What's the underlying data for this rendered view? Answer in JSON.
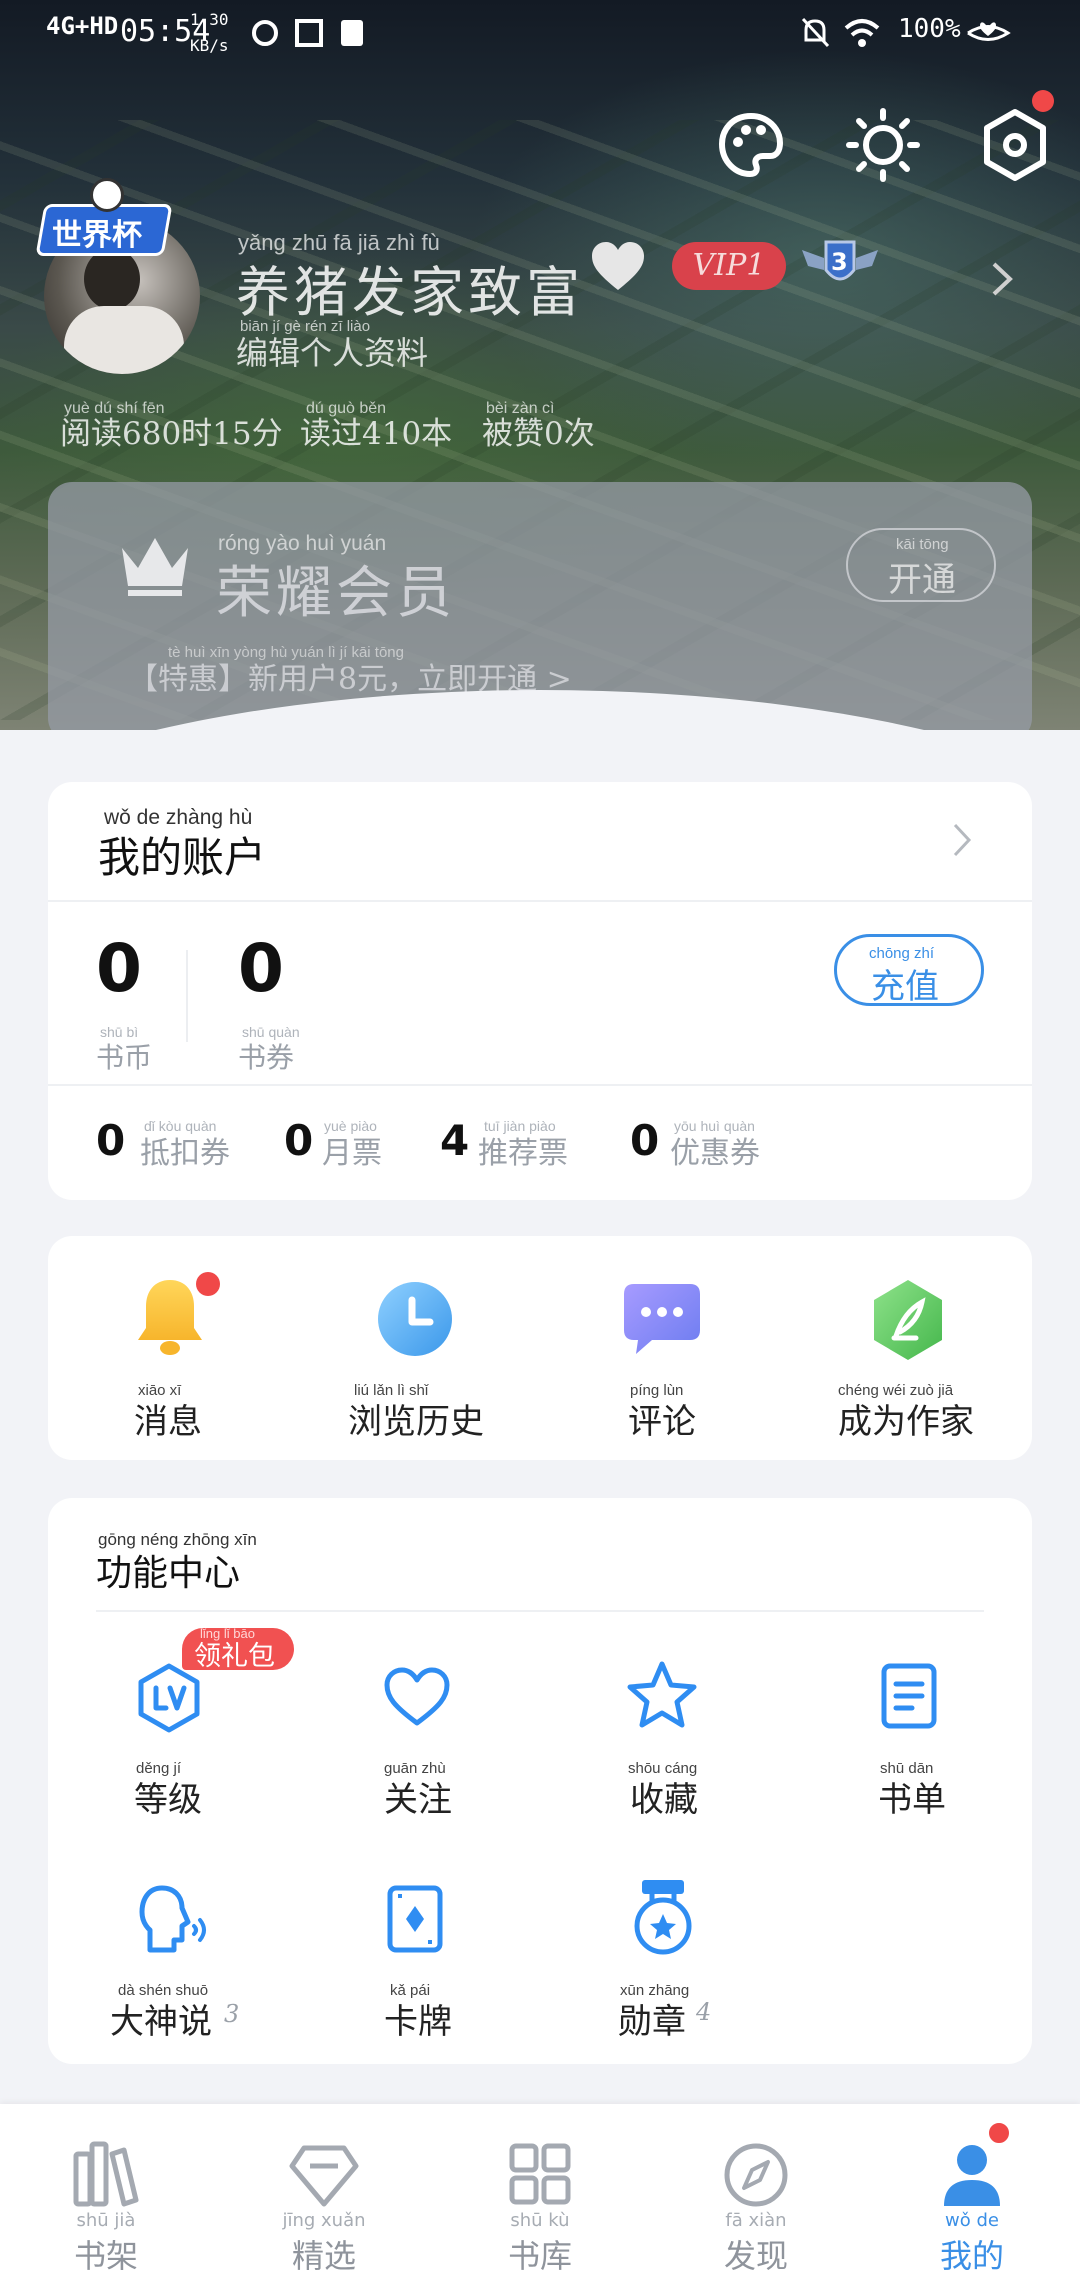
{
  "status": {
    "network": "4G+HD",
    "time": "05:54",
    "speed": "1.30",
    "speed_unit": "KB/s",
    "battery": "100%"
  },
  "profile": {
    "name": "养猪发家致富",
    "name_pinyin": "yǎng zhū fā jiā zhì fù",
    "vip": "VIP1",
    "badge_level": "3",
    "edit": "编辑个人资料",
    "edit_pinyin": "biān jí gè rén zī liào",
    "stats": [
      {
        "text": "阅读680时15分",
        "pinyin": "yuè dú shí fēn"
      },
      {
        "text": "读过410本",
        "pinyin": "dú guò běn"
      },
      {
        "text": "被赞0次",
        "pinyin": "bèi zàn cì"
      }
    ],
    "avatar_badge": "世界杯"
  },
  "vip_card": {
    "title": "荣耀会员",
    "title_pinyin": "róng yào huì yuán",
    "open": "开通",
    "open_pinyin": "kāi tōng",
    "promo": "【特惠】新用户8元，立即开通 >",
    "promo_pinyin": "tè huì xīn yòng hù yuán lì jí kāi tōng"
  },
  "account": {
    "title": "我的账户",
    "title_pinyin": "wǒ de zhàng hù",
    "coins": {
      "value": "0",
      "label": "书币",
      "pinyin": "shū bì"
    },
    "coupons": {
      "value": "0",
      "label": "书券",
      "pinyin": "shū quàn"
    },
    "recharge": "充值",
    "recharge_pinyin": "chōng zhí",
    "items": [
      {
        "value": "0",
        "label": "抵扣券",
        "pinyin": "dǐ kòu quàn"
      },
      {
        "value": "0",
        "label": "月票",
        "pinyin": "yuè piào"
      },
      {
        "value": "4",
        "label": "推荐票",
        "pinyin": "tuī jiàn piào"
      },
      {
        "value": "0",
        "label": "优惠券",
        "pinyin": "yōu huì quàn"
      }
    ]
  },
  "quick": [
    {
      "label": "消息",
      "pinyin": "xiāo xī",
      "icon": "bell-icon"
    },
    {
      "label": "浏览历史",
      "pinyin": "liú lǎn lì shǐ",
      "icon": "clock-icon"
    },
    {
      "label": "评论",
      "pinyin": "píng lùn",
      "icon": "comment-icon"
    },
    {
      "label": "成为作家",
      "pinyin": "chéng wéi zuò jiā",
      "icon": "feather-icon"
    }
  ],
  "functions": {
    "title": "功能中心",
    "title_pinyin": "gōng néng zhōng xīn",
    "gift_tag": "领礼包",
    "gift_pinyin": "lǐng lǐ bāo",
    "items": [
      {
        "label": "等级",
        "pinyin": "děng jí",
        "icon": "level-icon"
      },
      {
        "label": "关注",
        "pinyin": "guān zhù",
        "icon": "heart-icon"
      },
      {
        "label": "收藏",
        "pinyin": "shōu cáng",
        "icon": "star-icon"
      },
      {
        "label": "书单",
        "pinyin": "shū dān",
        "icon": "booklist-icon"
      },
      {
        "label": "大神说",
        "pinyin": "dà shén shuō",
        "count": "3",
        "icon": "voice-icon"
      },
      {
        "label": "卡牌",
        "pinyin": "kǎ pái",
        "icon": "card-icon"
      },
      {
        "label": "勋章",
        "pinyin": "xūn zhāng",
        "count": "4",
        "icon": "medal-icon"
      }
    ]
  },
  "tabs": [
    {
      "label": "书架",
      "pinyin": "shū jià"
    },
    {
      "label": "精选",
      "pinyin": "jīng xuǎn"
    },
    {
      "label": "书库",
      "pinyin": "shū kù"
    },
    {
      "label": "发现",
      "pinyin": "fā xiàn"
    },
    {
      "label": "我的",
      "pinyin": "wǒ de"
    }
  ],
  "colors": {
    "accent": "#3a8fe6",
    "badge_red": "#f04848",
    "vip_red": "#d9424b"
  }
}
